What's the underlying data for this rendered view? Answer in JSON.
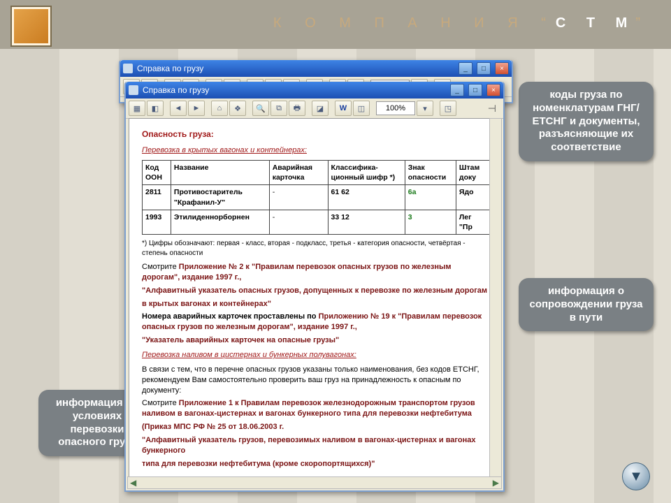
{
  "company": {
    "prefix": "К О М П А Н И Я   “",
    "brand": "С Т М",
    "suffix": "”"
  },
  "callouts": {
    "right1": "коды груза по номенклатурам ГНГ/ЕТСНГ и документы, разъясняющие их соответствие",
    "right2": "информация о сопровождении груза в пути",
    "left": "информация об условиях перевозки опасного груза"
  },
  "window": {
    "title": "Справка по грузу",
    "zoom": "100%"
  },
  "doc": {
    "heading": "Опасность груза:",
    "section1": "Перевозка в крытых вагонах и контейнерах:",
    "table": {
      "headers": [
        "Код ООН",
        "Название",
        "Аварийная карточка",
        "Классифика-\nционный шифр *)",
        "Знак опасности",
        "Штам\nдоку"
      ],
      "rows": [
        {
          "code": "2811",
          "name": "Противостаритель \"Крафанил-У\"",
          "card": "-",
          "class": "61 62",
          "sign": "6a",
          "stamp": "Ядо"
        },
        {
          "code": "1993",
          "name": "Этилиденнорборнен",
          "card": "-",
          "class": "33 12",
          "sign": "3",
          "stamp": "Лег\n\"Пр"
        }
      ]
    },
    "footnote": "*) Цифры обозначают: первая - класс, вторая - подкласс, третья - категория опасности, четвёртая - степень опасности",
    "see_intro": "Смотрите ",
    "ref1": "Приложение № 2 к \"Правилам перевозок опасных грузов по железным дорогам\", издание 1997 г.,",
    "ref2": "\"Алфавитный указатель опасных грузов, допущенных к перевозке по железным дорогам",
    "ref2b": "в крытых вагонах и контейнерах\"",
    "line_cards_intro": "Номера аварийных карточек проставлены по ",
    "ref3": "Приложению № 19 к \"Правилам перевозок опасных грузов по железным дорогам\", издание 1997 г.,",
    "ref4": "\"Указатель аварийных карточек на опасные грузы\"",
    "section2": "Перевозка наливом в цистернах и бункерных полувагонах:",
    "naliv_text": "В связи с тем, что в перечне опасных грузов указаны только наименования, без кодов ЕТСНГ, рекомендуем Вам самостоятельно проверить ваш груз на принадлежность к опасным по документу:",
    "ref5": "Приложение 1 к Правилам перевозок железнодорожным транспортом грузов наливом в вагонах-цистернах и вагонах бункерного типа для перевозки нефтебитума",
    "order": "(Приказ МПС РФ № 25 от 18.06.2003 г.",
    "ref6a": "\"Алфавитный указатель грузов, перевозимых наливом в вагонах-цистернах и вагонах бункерного",
    "ref6b": "типа для перевозки нефтебитума (кроме скоропортящихся)\""
  }
}
